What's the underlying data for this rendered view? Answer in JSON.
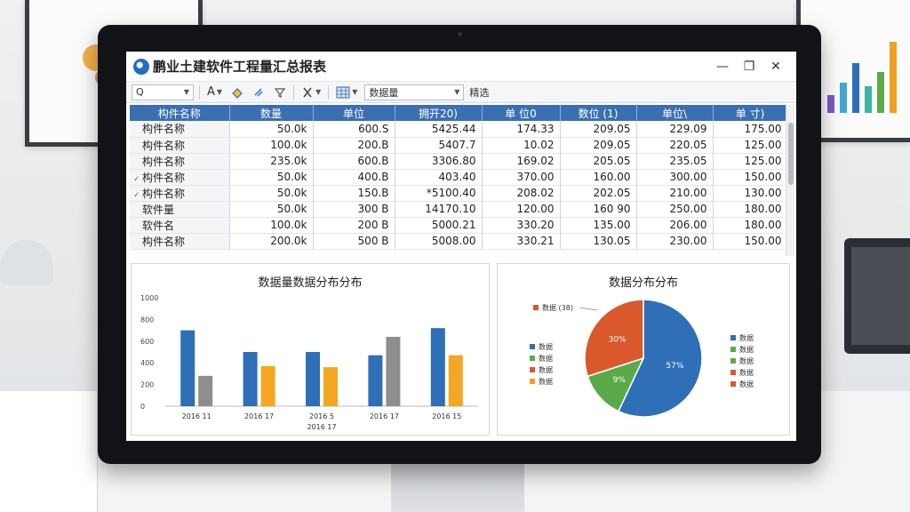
{
  "window": {
    "title": "鹏业土建软件工程量汇总报表",
    "minimize_glyph": "—",
    "maximize_glyph": "❐",
    "close_glyph": "✕"
  },
  "toolbar": {
    "search_value": "Q",
    "font_label": "A",
    "field_select_value": "数据量",
    "extra_label": "精选"
  },
  "table": {
    "headers": [
      "构件名称",
      "数量",
      "单位",
      "拥开20)",
      "单 位0",
      "数位 (1)",
      "单位\\",
      "单 寸)"
    ],
    "rows": [
      {
        "icon": "",
        "cells": [
          "构件名称",
          "50.0k",
          "600.S",
          "5425.44",
          "174.33",
          "209.05",
          "229.09",
          "175.00"
        ]
      },
      {
        "icon": "",
        "cells": [
          "构件名称",
          "100.0k",
          "200.B",
          "5407.7",
          "10.02",
          "209.05",
          "220.05",
          "125.00"
        ]
      },
      {
        "icon": "",
        "cells": [
          "构件名称",
          "235.0k",
          "600.B",
          "3306.80",
          "169.02",
          "205.05",
          "235.05",
          "125.00"
        ]
      },
      {
        "icon": "✓",
        "cells": [
          "构件名称",
          "50.0k",
          "400.B",
          "403.40",
          "370.00",
          "160.00",
          "300.00",
          "150.00"
        ]
      },
      {
        "icon": "✓",
        "cells": [
          "构件名称",
          "50.0k",
          "150.B",
          "*5100.40",
          "208.02",
          "202.05",
          "210.00",
          "130.00"
        ]
      },
      {
        "icon": "",
        "cells": [
          "软件量",
          "50.0k",
          "300 B",
          "14170.10",
          "120.00",
          "160 90",
          "250.00",
          "180.00"
        ]
      },
      {
        "icon": "",
        "cells": [
          "软件名",
          "100.0k",
          "200 B",
          "5000.21",
          "330.20",
          "135.00",
          "206.00",
          "180.00"
        ]
      },
      {
        "icon": "",
        "cells": [
          "构件名称",
          "200.0k",
          "500 B",
          "5008.00",
          "330.21",
          "130.05",
          "230.00",
          "150.00"
        ]
      }
    ]
  },
  "bar_panel": {
    "title": "数据量数据分布分布",
    "y_ticks": [
      "1000",
      "800",
      "600",
      "400",
      "200",
      "0"
    ],
    "x_labels": [
      "2016 11",
      "2016 17",
      "2016 5",
      "2016 17",
      "2016 15"
    ],
    "x_sub_label": "2016 17"
  },
  "pie_panel": {
    "title": "数据分布分布",
    "callout_label": "数据 (38)",
    "slice_labels": [
      "30%",
      "9%",
      "57%"
    ],
    "legend_left": [
      {
        "label": "数据",
        "color": "#2e6fb7"
      },
      {
        "label": "数据",
        "color": "#5aaa49"
      },
      {
        "label": "数据",
        "color": "#d9582c"
      },
      {
        "label": "数据",
        "color": "#f0a020"
      }
    ],
    "legend_right": [
      {
        "label": "数据",
        "color": "#2e6fb7"
      },
      {
        "label": "数据",
        "color": "#5aaa49"
      },
      {
        "label": "数据",
        "color": "#5aaa49"
      },
      {
        "label": "数据",
        "color": "#d9582c"
      },
      {
        "label": "数据",
        "color": "#d9582c"
      }
    ]
  },
  "chart_data": [
    {
      "type": "bar",
      "title": "数据量数据分布分布",
      "categories": [
        "2016 11",
        "2016 17",
        "2016 5",
        "2016 17",
        "2016 15"
      ],
      "ylim": [
        0,
        1000
      ],
      "series": [
        {
          "color": "#2e6fb7",
          "values": [
            700,
            500,
            500,
            470,
            720
          ]
        },
        {
          "color": "#8e8e8e",
          "values": [
            280,
            null,
            null,
            640,
            null
          ]
        },
        {
          "color": "#f5a623",
          "values": [
            null,
            370,
            360,
            null,
            470
          ]
        }
      ]
    },
    {
      "type": "pie",
      "title": "数据分布分布",
      "slices": [
        {
          "label": "57%",
          "value": 57,
          "color": "#2e6fb7"
        },
        {
          "label": "9%",
          "value": 13,
          "color": "#5aaa49"
        },
        {
          "label": "30%",
          "value": 30,
          "color": "#d9582c"
        }
      ]
    }
  ]
}
